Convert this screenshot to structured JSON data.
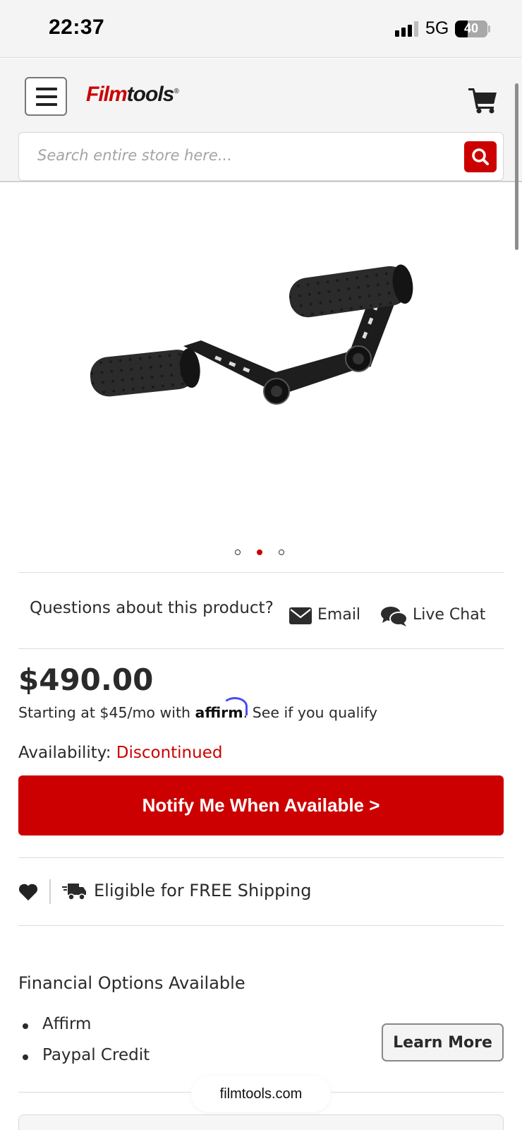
{
  "status_bar": {
    "time": "22:37",
    "network": "5G",
    "battery": "40",
    "battery_level": 0.4
  },
  "header": {
    "logo_part1": "Film",
    "logo_part2": "tools",
    "logo_mark": "®",
    "menu_icon": "hamburger-menu-icon",
    "cart_icon": "shopping-cart-icon"
  },
  "search": {
    "placeholder": "Search entire store here...",
    "button_icon": "search-icon"
  },
  "gallery": {
    "image_alt": "Red Pro dual handle grip",
    "slide_count": 3,
    "active_slide": 2
  },
  "support": {
    "question": "Questions about this product?",
    "email_label": "Email",
    "chat_label": "Live Chat"
  },
  "pricing": {
    "price": "$490.00",
    "financing_prefix": "Starting at $45/mo with ",
    "affirm_text": "affirm",
    "financing_suffix": ". See if you qualify"
  },
  "availability": {
    "label": "Availability: ",
    "status": "Discontinued"
  },
  "notify_button": "Notify Me When Available >",
  "shipping": {
    "text": "Eligible for FREE Shipping"
  },
  "financial_options": {
    "title": "Financial Options Available",
    "items": [
      "Affirm",
      "Paypal Credit"
    ],
    "button": "Learn More"
  },
  "browser": {
    "url": "filmtools.com"
  },
  "colors": {
    "brand_red": "#cc0000",
    "text_dark": "#2a2a2a",
    "affirm_blue": "#4a4af4"
  }
}
